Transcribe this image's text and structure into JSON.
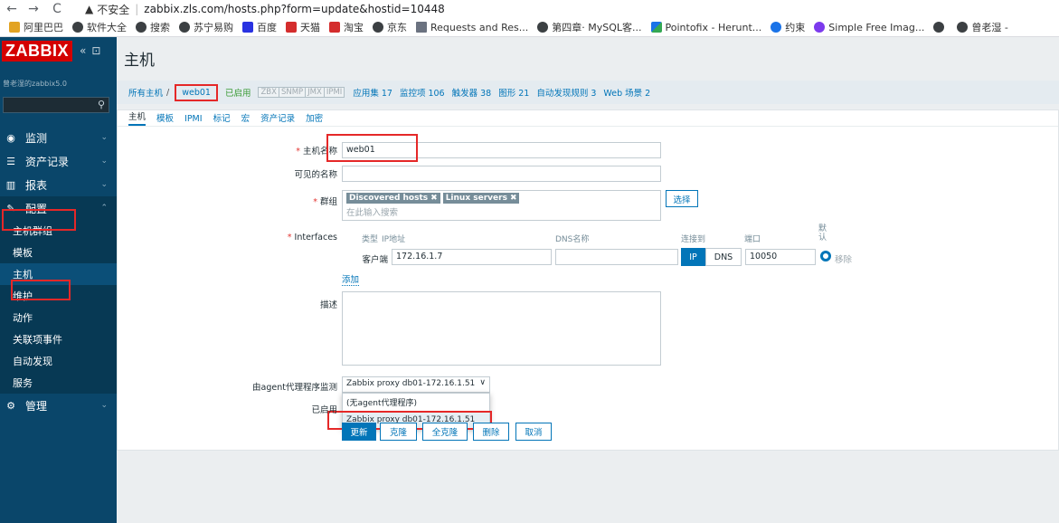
{
  "browser": {
    "back": "←",
    "forward": "→",
    "reload": "C",
    "warning_icon": "▲",
    "security_text": "不安全",
    "url": "zabbix.zls.com/hosts.php?form=update&hostid=10448",
    "bookmarks": [
      {
        "label": "阿里巴巴",
        "icon": "folder-icon"
      },
      {
        "label": "软件大全",
        "icon": "globe-icon"
      },
      {
        "label": "搜索",
        "icon": "globe-icon"
      },
      {
        "label": "苏宁易购",
        "icon": "globe-icon"
      },
      {
        "label": "百度",
        "icon": "baidu-icon"
      },
      {
        "label": "天猫",
        "icon": "tmall-icon"
      },
      {
        "label": "淘宝",
        "icon": "taobao-icon"
      },
      {
        "label": "京东",
        "icon": "globe-icon"
      },
      {
        "label": "Requests and Res...",
        "icon": "book-icon"
      },
      {
        "label": "第四章· MySQL客...",
        "icon": "globe-icon"
      },
      {
        "label": "Pointofix - Herunt...",
        "icon": "pointofix-icon"
      },
      {
        "label": "约束",
        "icon": "c-icon"
      },
      {
        "label": "Simple Free Imag...",
        "icon": "s-icon"
      },
      {
        "label": "",
        "icon": "globe-icon"
      },
      {
        "label": "曾老湿 -",
        "icon": "globe-icon"
      }
    ]
  },
  "sidebar": {
    "logo": "ZABBIX",
    "collapse": "«",
    "kiosk": "⊡",
    "server_name": "曾老湿的zabbix5.0",
    "search_placeholder": "",
    "menu": [
      {
        "label": "监测",
        "icon": "eye-icon",
        "glyph": "◉"
      },
      {
        "label": "资产记录",
        "icon": "list-icon",
        "glyph": "☰"
      },
      {
        "label": "报表",
        "icon": "report-icon",
        "glyph": "▥"
      },
      {
        "label": "配置",
        "icon": "wrench-icon",
        "glyph": "✎"
      }
    ],
    "submenu": [
      "主机群组",
      "模板",
      "主机",
      "维护",
      "动作",
      "关联项事件",
      "自动发现",
      "服务"
    ],
    "admin": {
      "label": "管理",
      "icon": "gear-icon",
      "glyph": "⚙"
    }
  },
  "header": {
    "title": "主机"
  },
  "filter_nav": {
    "all_hosts": "所有主机",
    "separator": "/",
    "current_host": "web01",
    "status": "已启用",
    "availability": [
      "ZBX",
      "SNMP",
      "JMX",
      "IPMI"
    ],
    "links": [
      "应用集 17",
      "监控项 106",
      "触发器 38",
      "图形 21",
      "自动发现规则 3",
      "Web 场景 2"
    ]
  },
  "tabs": [
    "主机",
    "模板",
    "IPMI",
    "标记",
    "宏",
    "资产记录",
    "加密"
  ],
  "form": {
    "host_name_label": "主机名称",
    "host_name_value": "web01",
    "visible_name_label": "可见的名称",
    "visible_name_value": "",
    "groups_label": "群组",
    "groups": [
      "Discovered hosts",
      "Linux servers"
    ],
    "group_remove": "✖",
    "groups_placeholder": "在此输入搜索",
    "select_button": "选择",
    "interfaces_label": "Interfaces",
    "col_type": "类型",
    "col_ip": "IP地址",
    "col_dns": "DNS名称",
    "col_connect": "连接到",
    "col_port": "端口",
    "col_default": "默认",
    "iface_type": "客户端",
    "iface_ip": "172.16.1.7",
    "iface_dns": "",
    "connect_ip": "IP",
    "connect_dns": "DNS",
    "iface_port": "10050",
    "remove": "移除",
    "add": "添加",
    "description_label": "描述",
    "description_value": "",
    "proxy_label": "由agent代理程序监测",
    "proxy_value": "Zabbix proxy db01-172.16.1.51",
    "proxy_chevron": "∨",
    "proxy_options": [
      "(无agent代理程序)",
      "Zabbix proxy db01-172.16.1.51"
    ],
    "enabled_label": "已启用",
    "buttons": {
      "update": "更新",
      "clone": "克隆",
      "full_clone": "全克隆",
      "delete": "删除",
      "cancel": "取消"
    }
  },
  "colors": {
    "accent": "#0275b8",
    "sidebar": "#0a466a",
    "highlight": "#e52828",
    "logo": "#d40000"
  }
}
